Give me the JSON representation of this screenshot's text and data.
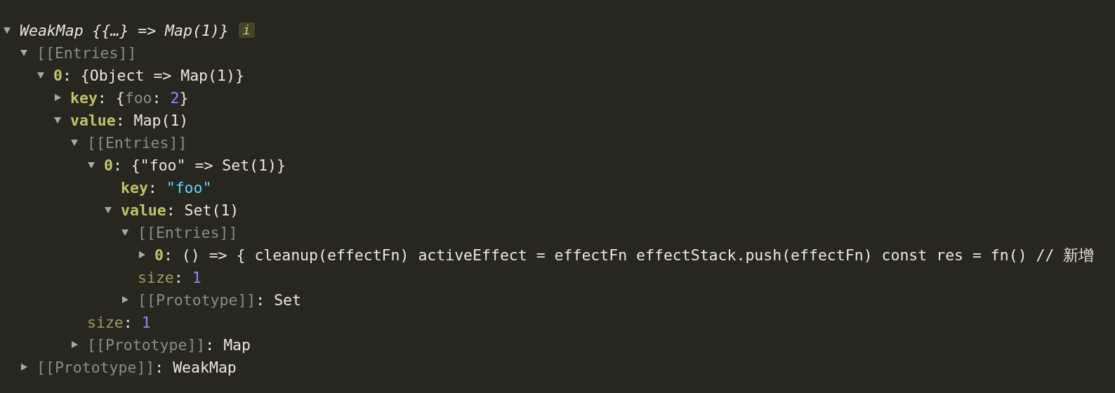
{
  "tree": [
    {
      "expanded": true,
      "parts": [
        {
          "kind": "italic",
          "text": "WeakMap {{…} => Map(1)}"
        }
      ],
      "badge": "i",
      "children": [
        {
          "expanded": true,
          "parts": [
            {
              "kind": "internal",
              "text": "[[Entries]]"
            }
          ],
          "children": [
            {
              "expanded": true,
              "parts": [
                {
                  "kind": "index",
                  "text": "0"
                },
                {
                  "kind": "plain",
                  "text": ": {Object => Map(1)}"
                }
              ],
              "children": [
                {
                  "expanded": false,
                  "parts": [
                    {
                      "kind": "key",
                      "text": "key"
                    },
                    {
                      "kind": "plain",
                      "text": ": {"
                    },
                    {
                      "kind": "dim",
                      "text": "foo"
                    },
                    {
                      "kind": "plain",
                      "text": ": "
                    },
                    {
                      "kind": "number",
                      "text": "2"
                    },
                    {
                      "kind": "plain",
                      "text": "}"
                    }
                  ]
                },
                {
                  "expanded": true,
                  "parts": [
                    {
                      "kind": "key",
                      "text": "value"
                    },
                    {
                      "kind": "plain",
                      "text": ": Map(1)"
                    }
                  ],
                  "children": [
                    {
                      "expanded": true,
                      "parts": [
                        {
                          "kind": "internal",
                          "text": "[[Entries]]"
                        }
                      ],
                      "children": [
                        {
                          "expanded": true,
                          "parts": [
                            {
                              "kind": "index",
                              "text": "0"
                            },
                            {
                              "kind": "plain",
                              "text": ": {\"foo\" => Set(1)}"
                            }
                          ],
                          "children": [
                            {
                              "parts": [
                                {
                                  "kind": "key",
                                  "text": "key"
                                },
                                {
                                  "kind": "plain",
                                  "text": ": "
                                },
                                {
                                  "kind": "string",
                                  "text": "\"foo\""
                                }
                              ]
                            },
                            {
                              "expanded": true,
                              "parts": [
                                {
                                  "kind": "key",
                                  "text": "value"
                                },
                                {
                                  "kind": "plain",
                                  "text": ": Set(1)"
                                }
                              ],
                              "children": [
                                {
                                  "expanded": true,
                                  "parts": [
                                    {
                                      "kind": "internal",
                                      "text": "[[Entries]]"
                                    }
                                  ],
                                  "children": [
                                    {
                                      "expanded": false,
                                      "parts": [
                                        {
                                          "kind": "index",
                                          "text": "0"
                                        },
                                        {
                                          "kind": "plain",
                                          "text": ": () => { cleanup(effectFn) activeEffect = effectFn effectStack.push(effectFn) const res = fn() // 新增"
                                        }
                                      ]
                                    }
                                  ]
                                },
                                {
                                  "parts": [
                                    {
                                      "kind": "meta",
                                      "text": "size"
                                    },
                                    {
                                      "kind": "plain",
                                      "text": ": "
                                    },
                                    {
                                      "kind": "number",
                                      "text": "1"
                                    }
                                  ]
                                },
                                {
                                  "expanded": false,
                                  "parts": [
                                    {
                                      "kind": "internal",
                                      "text": "[[Prototype]]"
                                    },
                                    {
                                      "kind": "plain",
                                      "text": ": Set"
                                    }
                                  ]
                                }
                              ]
                            }
                          ]
                        }
                      ]
                    },
                    {
                      "parts": [
                        {
                          "kind": "meta",
                          "text": "size"
                        },
                        {
                          "kind": "plain",
                          "text": ": "
                        },
                        {
                          "kind": "number",
                          "text": "1"
                        }
                      ]
                    },
                    {
                      "expanded": false,
                      "parts": [
                        {
                          "kind": "internal",
                          "text": "[[Prototype]]"
                        },
                        {
                          "kind": "plain",
                          "text": ": Map"
                        }
                      ]
                    }
                  ]
                }
              ]
            }
          ]
        },
        {
          "expanded": false,
          "parts": [
            {
              "kind": "internal",
              "text": "[[Prototype]]"
            },
            {
              "kind": "plain",
              "text": ": WeakMap"
            }
          ]
        }
      ]
    }
  ]
}
